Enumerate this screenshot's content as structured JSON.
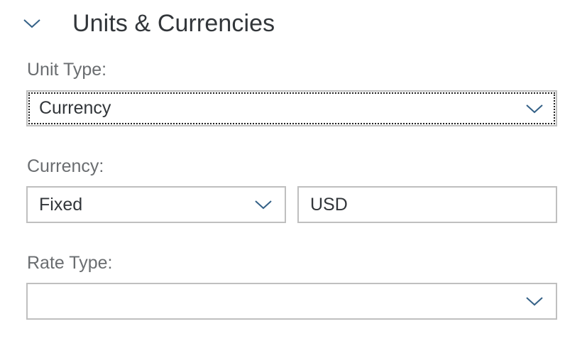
{
  "section": {
    "title": "Units & Currencies",
    "collapse_icon": "chevron-down-icon"
  },
  "unit_type": {
    "label": "Unit Type:",
    "value": "Currency"
  },
  "currency": {
    "label": "Currency:",
    "mode_value": "Fixed",
    "code_value": "USD"
  },
  "rate_type": {
    "label": "Rate Type:",
    "value": ""
  },
  "colors": {
    "accent": "#346187",
    "border": "#bfbfbf",
    "label": "#6a6d70",
    "text": "#32363a"
  }
}
